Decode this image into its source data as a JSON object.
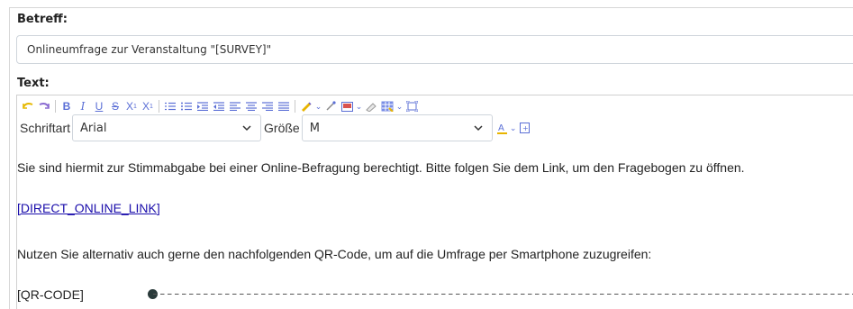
{
  "subject": {
    "label": "Betreff:",
    "value": "Onlineumfrage zur Veranstaltung \"[SURVEY]\""
  },
  "text": {
    "label": "Text:"
  },
  "toolbar": {
    "font_label": "Schriftart",
    "font_value": "Arial",
    "size_label": "Größe",
    "size_value": "M"
  },
  "body": {
    "paragraph1": "Sie sind hiermit zur Stimmabgabe bei einer Online-Befragung berechtigt. Bitte folgen Sie dem Link, um den Fragebogen zu öffnen.",
    "link": "[DIRECT_ONLINE_LINK]",
    "paragraph2": "Nutzen Sie alternativ auch gerne den nachfolgenden QR-Code, um auf die Umfrage per Smartphone zuzugreifen:",
    "qr_placeholder": "[QR-CODE]"
  },
  "colors": {
    "toolbar_icon": "#5b6fd6",
    "link": "#1a0dab",
    "border": "#cfd5dc"
  }
}
